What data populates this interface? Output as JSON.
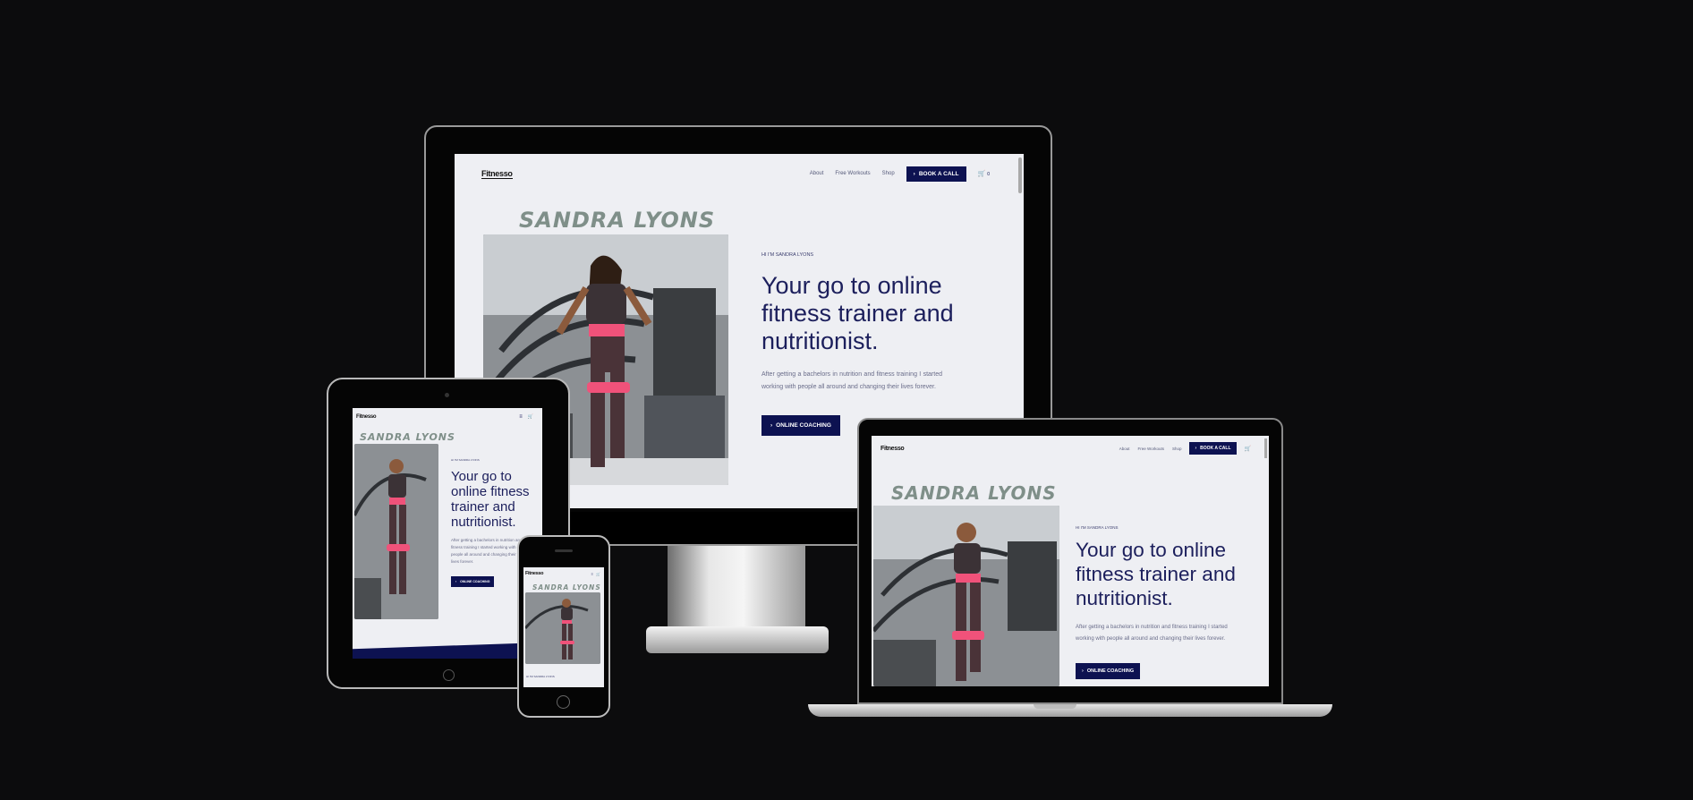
{
  "site": {
    "logo": "Fitnesso",
    "nav": {
      "about": "About",
      "free_workouts": "Free Workouts",
      "shop": "Shop",
      "book_call": "BOOK A CALL",
      "cart_count": "0",
      "menu_icon": "hamburger-icon",
      "cart_icon": "cart-icon"
    },
    "hero": {
      "name_script": "SANDRA LYONS",
      "eyebrow": "HI I'M SANDRA LYONS",
      "headline": "Your go to online fitness trainer and nutritionist.",
      "paragraph": "After getting a bachelors in nutrition and fitness training I started working with people all around and changing their lives forever.",
      "cta": "ONLINE COACHING"
    }
  },
  "colors": {
    "background": "#0c0c0d",
    "site_bg": "#eeeff3",
    "navy": "#0d1251",
    "heading": "#1c1f5c",
    "script_name": "#7f8f89",
    "accent_pink": "#f0527a"
  },
  "devices": [
    "desktop-monitor",
    "tablet",
    "phone",
    "laptop"
  ]
}
